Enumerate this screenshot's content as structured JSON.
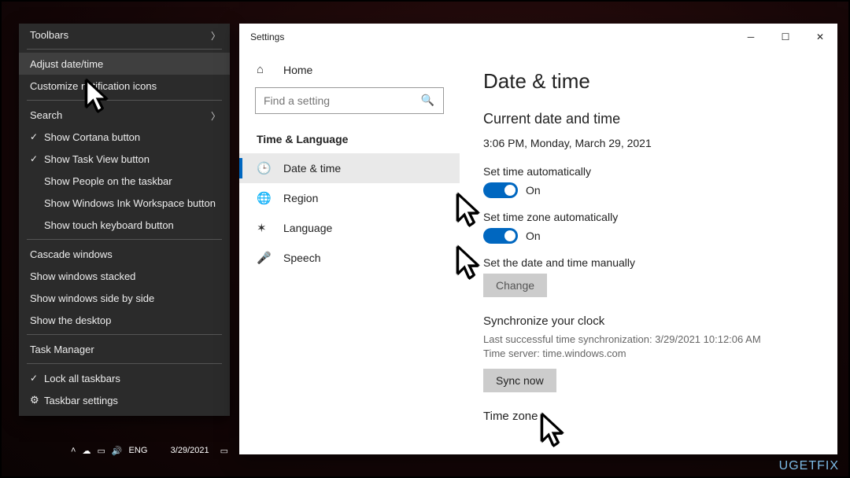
{
  "context_menu": {
    "toolbars": "Toolbars",
    "adjust_date": "Adjust date/time",
    "customize_icons": "Customize notification icons",
    "search": "Search",
    "show_cortana": "Show Cortana button",
    "show_taskview": "Show Task View button",
    "show_people": "Show People on the taskbar",
    "show_ink": "Show Windows Ink Workspace button",
    "show_touchkb": "Show touch keyboard button",
    "cascade": "Cascade windows",
    "stacked": "Show windows stacked",
    "sidebyside": "Show windows side by side",
    "desktop": "Show the desktop",
    "taskmgr": "Task Manager",
    "lock_tb": "Lock all taskbars",
    "tb_settings": "Taskbar settings"
  },
  "taskbar": {
    "lang": "ENG",
    "date": "3/29/2021"
  },
  "settings": {
    "window_title": "Settings",
    "home": "Home",
    "search_placeholder": "Find a setting",
    "category": "Time & Language",
    "nav": {
      "datetime": "Date & time",
      "region": "Region",
      "language": "Language",
      "speech": "Speech"
    },
    "page_title": "Date & time",
    "current_title": "Current date and time",
    "current_value": "3:06 PM, Monday, March 29, 2021",
    "set_time_auto": "Set time automatically",
    "set_tz_auto": "Set time zone automatically",
    "on_label": "On",
    "manual_label": "Set the date and time manually",
    "change_btn": "Change",
    "sync_title": "Synchronize your clock",
    "sync_last": "Last successful time synchronization: 3/29/2021 10:12:06 AM",
    "sync_server": "Time server: time.windows.com",
    "sync_btn": "Sync now",
    "timezone_heading": "Time zone"
  },
  "watermark": "UGETFIX"
}
